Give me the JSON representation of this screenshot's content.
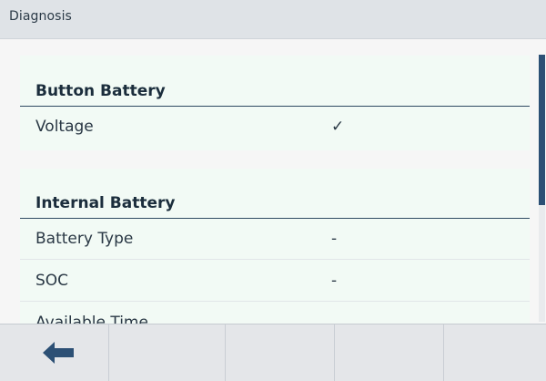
{
  "header": {
    "title": "Diagnosis"
  },
  "sections": [
    {
      "title": "Button Battery",
      "rows": [
        {
          "label": "Voltage",
          "value": "✓"
        }
      ]
    },
    {
      "title": "Internal Battery",
      "rows": [
        {
          "label": "Battery Type",
          "value": "-"
        },
        {
          "label": "SOC",
          "value": "-"
        },
        {
          "label": "Available Time",
          "value": ""
        }
      ]
    }
  ],
  "toolbar": {
    "buttons": [
      {
        "icon": "arrow-left-icon"
      },
      {
        "icon": ""
      },
      {
        "icon": ""
      },
      {
        "icon": ""
      },
      {
        "icon": ""
      }
    ]
  },
  "colors": {
    "accent": "#2c5075",
    "section_background": "#f2faf5",
    "header_background": "#dfe3e7",
    "toolbar_background": "#e4e6e9"
  }
}
